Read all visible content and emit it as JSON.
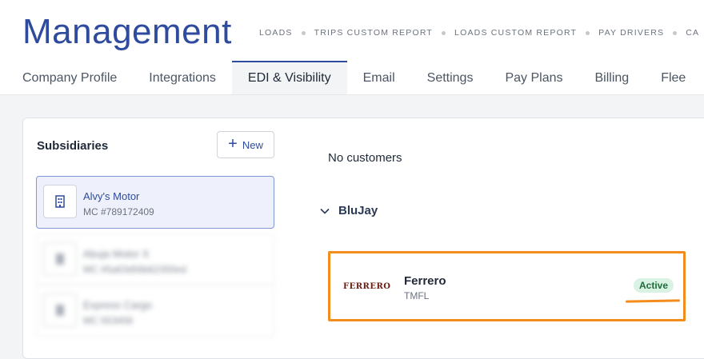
{
  "header": {
    "title": "Management",
    "quicklinks": [
      "LOADS",
      "TRIPS CUSTOM REPORT",
      "LOADS CUSTOM REPORT",
      "PAY DRIVERS",
      "CA"
    ]
  },
  "tabs": [
    {
      "label": "Company Profile"
    },
    {
      "label": "Integrations"
    },
    {
      "label": "EDI & Visibility",
      "active": true
    },
    {
      "label": "Email"
    },
    {
      "label": "Settings"
    },
    {
      "label": "Pay Plans"
    },
    {
      "label": "Billing"
    },
    {
      "label": "Flee"
    }
  ],
  "subsidiaries": {
    "title": "Subsidiaries",
    "new_label": "New",
    "items": [
      {
        "name": "Alvy's Motor",
        "mc": "MC #789172409",
        "selected": true
      },
      {
        "name": "Abuja Motor X",
        "mc": "MC #5a63d56b62350ed",
        "blurred": true
      },
      {
        "name": "Express Cargo",
        "mc": "MC 553456",
        "blurred": true
      }
    ]
  },
  "customers": {
    "empty_text": "No customers",
    "group": "BluJay",
    "card": {
      "logo_text": "FERRERO",
      "name": "Ferrero",
      "code": "TMFL",
      "status": "Active"
    }
  },
  "colors": {
    "brand": "#2f4b9e",
    "highlight": "#f28c1c",
    "status_bg": "#d9f2e3",
    "status_text": "#1e6b3a"
  }
}
